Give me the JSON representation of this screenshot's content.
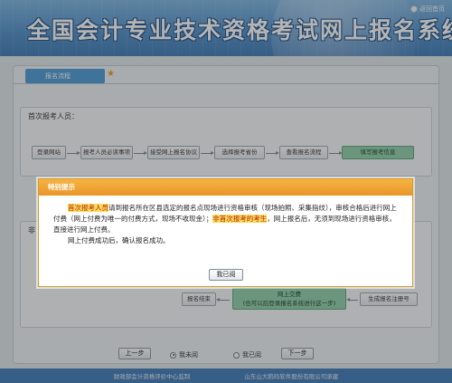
{
  "header": {
    "title": "全国会计专业技术资格考试网上报名系统",
    "return_link": "返回首页"
  },
  "tab": {
    "label": "报名流程"
  },
  "first_section": {
    "title": "首次报考人员：",
    "steps": [
      "登录网站",
      "报考人员必读事项",
      "接受网上报名协议",
      "选择报考省份",
      "查看报名流程",
      "填写报考信息"
    ]
  },
  "second_section": {
    "title": "非",
    "steps": {
      "finish": "报名结束",
      "pay_line1": "网上交费",
      "pay_line2": "(也可以后登录报名系统进行这一步)",
      "generate_id": "生成报名注册号"
    }
  },
  "nav": {
    "prev": "上一步",
    "not_read": "我未阅",
    "read": "我已阅",
    "next": "下一步"
  },
  "footer": {
    "supervisor": "财政部会计资格评价中心监制",
    "developer": "山东山大鸥玛软件股份有限公司承建"
  },
  "modal": {
    "title": "特别提示",
    "highlight_first": "首次报考人员",
    "text_1": "请到报名所在区县选定的报名点现场进行资格审核（现场拍照、采集指纹），审核合格后进行网上付费（网上付费为唯一的付费方式，现场不收现金）；",
    "highlight_non_first": "非首次报考的考生",
    "text_2": "，网上报名后，无须到现场进行资格审核，直接进行网上付费。",
    "text_3": "网上付费成功后，确认报名成功。",
    "button": "我已阅"
  }
}
